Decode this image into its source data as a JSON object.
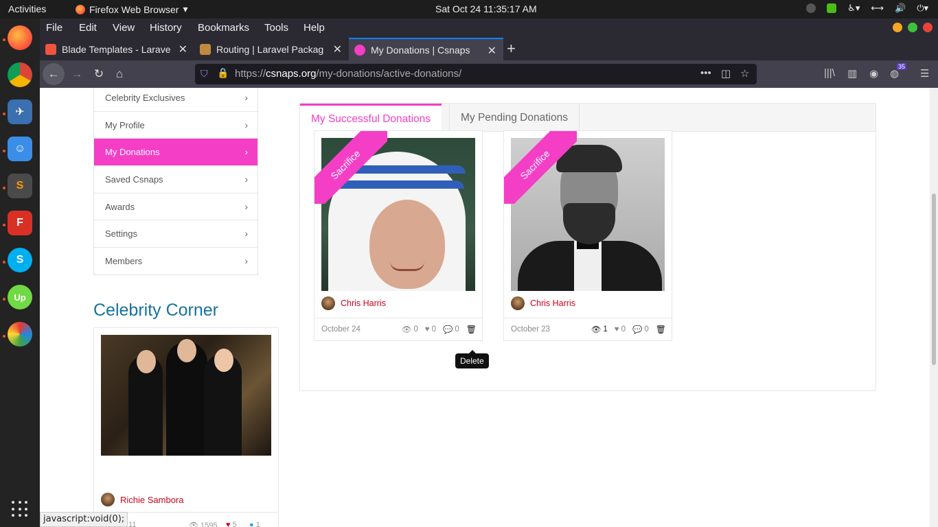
{
  "topbar": {
    "activities": "Activities",
    "app_name": "Firefox Web Browser",
    "clock": "Sat Oct 24  11:35:17 AM"
  },
  "firefox": {
    "menu": [
      "File",
      "Edit",
      "View",
      "History",
      "Bookmarks",
      "Tools",
      "Help"
    ],
    "tabs": [
      {
        "title": "Blade Templates - Larave",
        "icon_color": "#f05340"
      },
      {
        "title": "Routing | Laravel Packag",
        "icon_color": "#c08a40"
      },
      {
        "title": "My Donations | Csnaps",
        "icon_color": "#f53ec6"
      }
    ],
    "url_prefix": "https://",
    "url_domain": "csnaps.org",
    "url_path": "/my-donations/active-donations/",
    "notification_count": "35"
  },
  "sidebar": {
    "items": [
      {
        "label": "Celebrity Exclusives",
        "active": false
      },
      {
        "label": "My Profile",
        "active": false
      },
      {
        "label": "My Donations",
        "active": true
      },
      {
        "label": "Saved Csnaps",
        "active": false
      },
      {
        "label": "Awards",
        "active": false
      },
      {
        "label": "Settings",
        "active": false
      },
      {
        "label": "Members",
        "active": false
      }
    ]
  },
  "celebrity_corner": {
    "title": "Celebrity Corner",
    "author": "Richie Sambora",
    "date_partial": "11",
    "views": "1595",
    "likes": "5",
    "comments": "1"
  },
  "donation_tabs": {
    "successful": "My Successful Donations",
    "pending": "My Pending Donations"
  },
  "donations": [
    {
      "ribbon": "Sacrifice",
      "author": "Chris Harris",
      "date": "October 24",
      "views": "0",
      "likes": "0",
      "comments": "0"
    },
    {
      "ribbon": "Sacrifice",
      "author": "Chris Harris",
      "date": "October 23",
      "views": "1",
      "likes": "0",
      "comments": "0"
    }
  ],
  "tooltip": "Delete",
  "status_text": "javascript:void(0);",
  "colors": {
    "accent": "#f53ec6",
    "author": "#d0021b",
    "heading": "#17729c"
  }
}
